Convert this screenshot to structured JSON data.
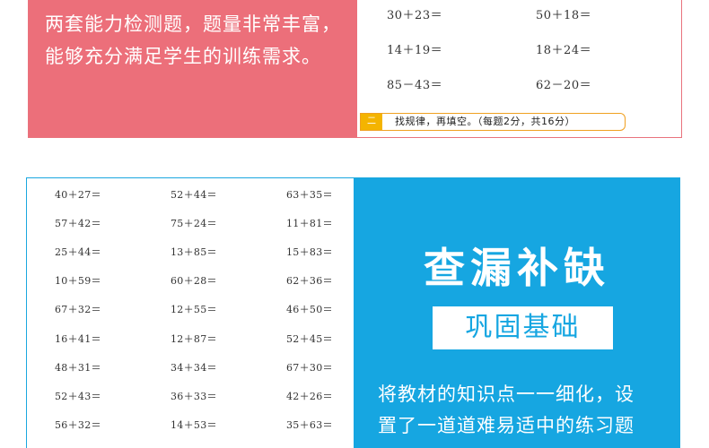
{
  "top_panel": {
    "lines": [
      "两套能力检测题，题量非常丰富，",
      "能够充分满足学生的训练需求。"
    ],
    "equations": [
      [
        "30＋23＝",
        "50＋18＝"
      ],
      [
        "14＋19＝",
        "18＋24＝"
      ],
      [
        "85－43＝",
        "62－20＝"
      ]
    ],
    "instruction_number": "二",
    "instruction_text": "找规律，再填空。（每题2分，共16分）"
  },
  "bottom_panel": {
    "equations": [
      [
        "40＋27＝",
        "52＋44＝",
        "63＋35＝"
      ],
      [
        "57＋42＝",
        "75＋24＝",
        "11＋81＝"
      ],
      [
        "25＋44＝",
        "13＋85＝",
        "15＋83＝"
      ],
      [
        "10＋59＝",
        "60＋28＝",
        "62＋36＝"
      ],
      [
        "67＋32＝",
        "12＋55＝",
        "46＋50＝"
      ],
      [
        "16＋41＝",
        "12＋87＝",
        "52＋45＝"
      ],
      [
        "48＋31＝",
        "34＋34＝",
        "67＋30＝"
      ],
      [
        "52＋43＝",
        "36＋33＝",
        "42＋26＝"
      ],
      [
        "56＋32＝",
        "14＋53＝",
        "35＋63＝"
      ]
    ],
    "title": "查漏补缺",
    "subtitle": "巩固基础",
    "desc_lines": [
      "将教材的知识点一一细化，设",
      "置了一道道难易适中的练习题"
    ]
  },
  "colors": {
    "pink": "#ec6f7a",
    "blue": "#16a6e1",
    "orange": "#f4b400"
  }
}
